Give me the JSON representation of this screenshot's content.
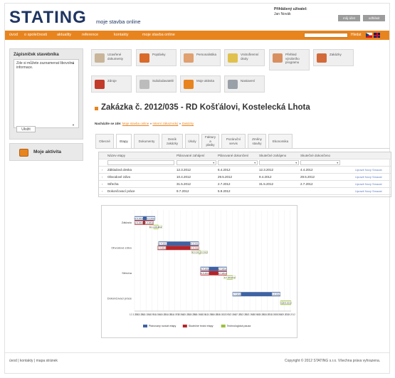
{
  "header": {
    "logo_main": "STATING",
    "logo_sub": "moje stavba online",
    "user_label": "Přihlášený uživatel:",
    "user_name": "Jan Novák",
    "profile_button": "můj účet",
    "logout_button": "odhlásit"
  },
  "nav": {
    "items": [
      "úvod",
      "o společnosti",
      "aktuality",
      "reference",
      "kontakty",
      "moje stavba online"
    ],
    "search_button": "Hledat",
    "search_value": ""
  },
  "sidebar": {
    "panel_title": "Zápisníček stavebníka",
    "panel_text": "Zde si můžete zaznamenat libovolné informace.",
    "save_button": "Uložit",
    "activity_label": "Moje aktivita"
  },
  "tiles": [
    {
      "label": "Uzavřené\ndokumenty",
      "icon": "documents-icon",
      "color": "#c9b59a"
    },
    {
      "label": "Poptávky",
      "icon": "inquiry-icon",
      "color": "#d96a2a"
    },
    {
      "label": "Personalistika",
      "icon": "person-icon",
      "color": "#e0a070"
    },
    {
      "label": "Vnitrofiremní\núkoly",
      "icon": "tasks-icon",
      "color": "#e1c14d"
    },
    {
      "label": "Přehled\nvýrobního\nprogramu",
      "icon": "overview-icon",
      "color": "#d89060"
    },
    {
      "label": "Zakázky",
      "icon": "house-icon",
      "color": "#d36a3a"
    },
    {
      "label": "Zdroje",
      "icon": "resources-icon",
      "color": "#c23a2a"
    },
    {
      "label": "Subdodavatelé",
      "icon": "gears-icon",
      "color": "#bcbcbc"
    },
    {
      "label": "Moje aktivita",
      "icon": "briefcase-icon",
      "color": "#e8841e"
    },
    {
      "label": "Nastavení",
      "icon": "tools-icon",
      "color": "#9aa0a8"
    }
  ],
  "main": {
    "title": "Zakázka č. 2012/035 - RD Košťálovi, Kostelecká Lhota",
    "crumb_label": "Nacházíte se zde:",
    "crumb_links": [
      "Moje stavba online",
      "Interní zákaznický",
      "Zakázky"
    ]
  },
  "tabs": [
    "Obecné",
    "Etapy",
    "Dokumenty",
    "Deník\nzakázky",
    "Úkoly",
    "Faktury\na\nplatby",
    "Pozáruční\nservis",
    "Změny\nstavby",
    "Ekonomika"
  ],
  "table": {
    "headers": [
      "Název etapy",
      "Plánované zahájení",
      "Plánované dokončení",
      "Skutečné zahájeno",
      "Skutečné dokončeno"
    ],
    "rows": [
      [
        "Základová deska",
        "12.3.2012",
        "6.4.2012",
        "12.3.2012",
        "4.4.2012"
      ],
      [
        "Obvodové zdivo",
        "10.4.2012",
        "29.5.2012",
        "9.4.2012",
        "29.5.2012"
      ],
      [
        "Střecha",
        "31.5.2012",
        "2.7.2012",
        "31.5.2012",
        "2.7.2012"
      ],
      [
        "Dokončovací práce",
        "9.7.2012",
        "5.9.2012",
        "",
        ""
      ]
    ],
    "row_actions": "Upravit Nový Smazat"
  },
  "chart_data": {
    "type": "gantt",
    "categories": [
      "Základová deska",
      "Obvodové zdivo",
      "Střecha",
      "Dokončovací práce"
    ],
    "category_labels": [
      "Základo",
      "Obvodové zdivo",
      "Střecha",
      "Dokončovací práce"
    ],
    "x_start": "2012-03-12",
    "x_end": "2012-09-18",
    "x_ticks": [
      "12.3.2012",
      "19.3.2012",
      "26.3.2012",
      "2.4.2012",
      "9.4.2012",
      "16.4.2012",
      "23.4.2012",
      "30.4.2012",
      "7.5.2012",
      "14.5.2012",
      "21.5.2012",
      "28.5.2012",
      "4.6.2012",
      "11.6.2012",
      "18.6.2012",
      "25.6.2012",
      "2.7.2012",
      "9.7.2012",
      "16.7.2012",
      "23.7.2012",
      "30.7.2012",
      "6.8.2012",
      "13.8.2012",
      "20.8.2012",
      "27.8.2012",
      "3.9.2012",
      "10.9.2012",
      "17.9.2012"
    ],
    "series": [
      {
        "name": "Plánovaný rozsah etapy",
        "color": "#3e62a3",
        "values": [
          [
            "2012-03-12",
            "2012-04-06"
          ],
          [
            "2012-04-10",
            "2012-05-29"
          ],
          [
            "2012-05-31",
            "2012-07-02"
          ],
          [
            "2012-07-09",
            "2012-09-05"
          ]
        ]
      },
      {
        "name": "Skutečné trvání etapy",
        "color": "#b3252a",
        "values": [
          [
            "2012-03-12",
            "2012-04-04"
          ],
          [
            "2012-04-09",
            "2012-05-29"
          ],
          [
            "2012-05-31",
            "2012-07-02"
          ],
          null
        ]
      },
      {
        "name": "Technologická pauza",
        "color": "#9abf3e",
        "values": [
          [
            "2012-04-04",
            "2012-04-10"
          ],
          [
            "2012-05-29",
            "2012-05-31"
          ],
          [
            "2012-07-02",
            "2012-07-09"
          ],
          [
            "2012-09-05",
            "2012-09-18"
          ]
        ]
      }
    ],
    "bar_labels": [
      [
        "12.3.2012",
        "6.4.2012"
      ],
      [
        "10.4.2012",
        "29.5.2012"
      ],
      [
        "31.5.2012",
        "2.7.2012"
      ],
      [
        "9.7.2012",
        "5.9.2012"
      ]
    ],
    "actual_labels": [
      [
        "12.3.2012",
        "4.4.2012"
      ],
      [
        "9.4.2012",
        "29.5.2012"
      ],
      [
        "31.5.2012",
        "2.7.2012"
      ],
      null
    ],
    "pause_labels": [
      [
        "4.4.2012",
        "10.4.2012"
      ],
      [
        "29.5.2012",
        "30.5.2012"
      ],
      [
        "2.7.2012",
        "9.7.2012"
      ],
      [
        "5.9.2012",
        "18.9.2012"
      ]
    ],
    "legend_position": "bottom"
  },
  "footer": {
    "left": "úvod | kontakty | mapa stránek",
    "right": "Copyright © 2012 STATING s.r.o. Všechna práva vyhrazena."
  }
}
